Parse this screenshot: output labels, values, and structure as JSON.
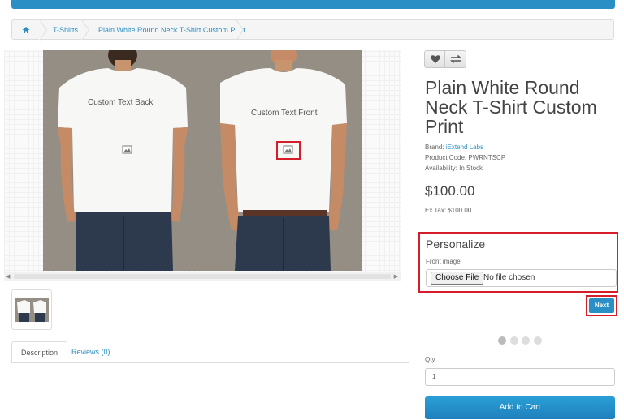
{
  "breadcrumb": {
    "items": [
      {
        "icon": "home-icon",
        "label": ""
      },
      {
        "label": "T-Shirts"
      },
      {
        "label": "Plain White Round Neck T-Shirt Custom Print"
      }
    ]
  },
  "gallery": {
    "back_text": "Custom Text Back",
    "front_text": "Custom Text Front"
  },
  "tabs": [
    {
      "label": "Description",
      "active": true
    },
    {
      "label": "Reviews (0)",
      "active": false
    }
  ],
  "actions": {
    "wishlist_icon": "heart-icon",
    "compare_icon": "exchange-icon"
  },
  "product": {
    "title": "Plain White Round Neck T-Shirt Custom Print",
    "brand_label": "Brand:",
    "brand_value": "iExtend Labs",
    "code_label": "Product Code:",
    "code_value": "PWRNTSCP",
    "availability_label": "Availability:",
    "availability_value": "In Stock",
    "price": "$100.00",
    "ex_tax_label": "Ex Tax:",
    "ex_tax_value": "$100.00"
  },
  "personalize": {
    "title": "Personalize",
    "field_label": "Front image",
    "choose_button": "Choose File",
    "no_file_text": "No file chosen",
    "next_button": "Next"
  },
  "steps": {
    "total": 4,
    "active": 1
  },
  "purchase": {
    "qty_label": "Qty",
    "qty_value": "1",
    "add_to_cart": "Add to Cart"
  },
  "colors": {
    "accent": "#2a8fc4",
    "highlight": "#d61e2b"
  }
}
